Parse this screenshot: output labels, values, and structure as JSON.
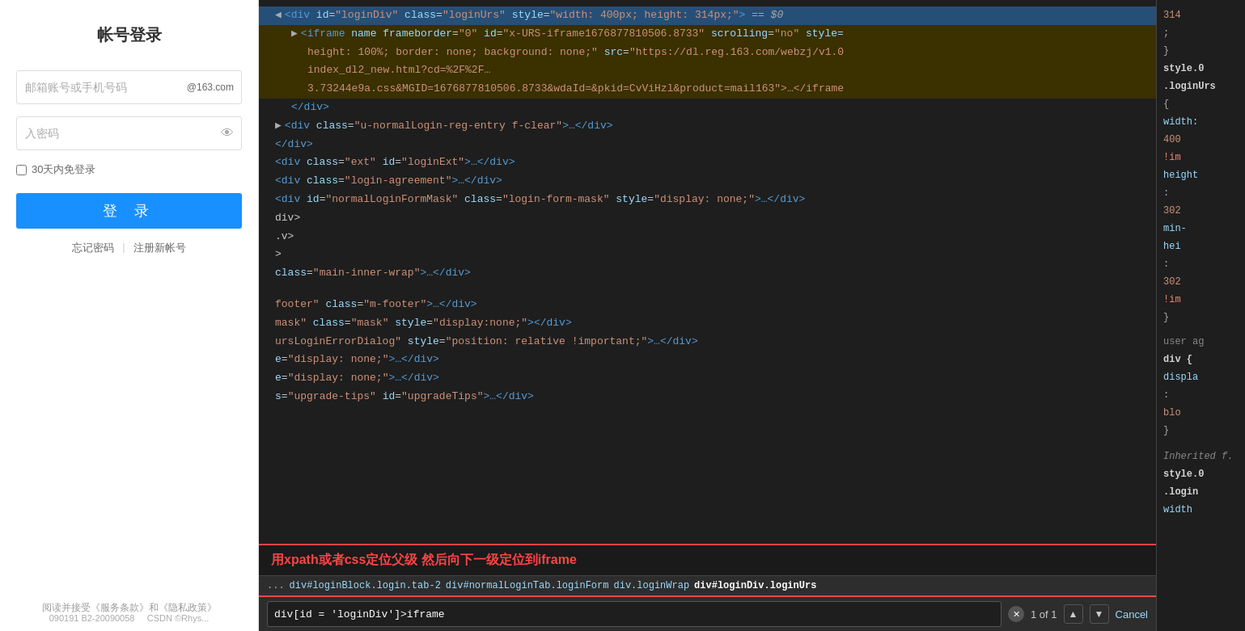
{
  "leftPanel": {
    "title": "帐号登录",
    "emailPlaceholder": "邮箱账号或手机号码",
    "emailSuffix": "@163.com",
    "passwordPlaceholder": "入密码",
    "rememberLabel": "30天内免登录",
    "loginButton": "登 录",
    "forgotPassword": "忘记密码",
    "registerLink": "注册新帐号",
    "agreementText": "阅读并接受《服务条款》和《隐私政策》",
    "footerText": "090191  B2-20090058",
    "csdn": "CSDN ©Rhys..."
  },
  "devtools": {
    "lines": [
      {
        "id": "line1",
        "type": "selected-blue",
        "content": "◀ <div id=\"loginDiv\" class=\"loginUrs\" style=\"width: 400px; height: 314px;\"> == $0"
      },
      {
        "id": "line2",
        "type": "selected-yellow",
        "content": "  ▶ <iframe name frameborder=\"0\" id=\"x-URS-iframe1676877810506.8733\" scrolling=\"no\" style="
      },
      {
        "id": "line3",
        "type": "selected-yellow",
        "indent": "    ",
        "content": "      height: 100%; border: none; background: none;\" src=\"https://dl.reg.163.com/webzj/v1.0"
      },
      {
        "id": "line4",
        "type": "selected-yellow",
        "content": "      index_dl2_new.html?cd=%2F%2F…"
      },
      {
        "id": "line5",
        "type": "selected-yellow",
        "content": "      3.73244e9a.css&MGID=1676877810506.8733&wdaId=&pkid=CvViHzl&product=mail163\">…</iframe"
      },
      {
        "id": "line6",
        "type": "normal",
        "content": "    </div>"
      },
      {
        "id": "line7",
        "type": "normal",
        "content": "  ▶ <div class=\"u-normalLogin-reg-entry f-clear\">…</div>"
      },
      {
        "id": "line8",
        "type": "normal",
        "content": "</div>"
      },
      {
        "id": "line9",
        "type": "normal",
        "content": "<div class=\"ext\" id=\"loginExt\">…</div>"
      },
      {
        "id": "line10",
        "type": "normal",
        "content": "<div class=\"login-agreement\">…</div>"
      },
      {
        "id": "line11",
        "type": "normal",
        "content": "<div id=\"normalLoginFormMask\" class=\"login-form-mask\" style=\"display: none;\">…</div>"
      },
      {
        "id": "line12",
        "type": "normal",
        "content": "div>"
      },
      {
        "id": "line13",
        "type": "normal",
        "content": ".v>"
      },
      {
        "id": "line14",
        "type": "normal",
        "content": ">"
      },
      {
        "id": "line15",
        "type": "normal",
        "content": "class=\"main-inner-wrap\">…</div>"
      },
      {
        "id": "line16",
        "type": "normal",
        "content": ""
      },
      {
        "id": "line17",
        "type": "normal",
        "content": "footer\" class=\"m-footer\">…</div>"
      },
      {
        "id": "line18",
        "type": "normal",
        "content": "mask\" class=\"mask\" style=\"display:none;\"></div>"
      },
      {
        "id": "line19",
        "type": "normal",
        "content": "ursLoginErrorDialog\" style=\"position: relative !important;\">…</div>"
      },
      {
        "id": "line20",
        "type": "normal",
        "content": "e=\"display: none;\">…</div>"
      },
      {
        "id": "line21",
        "type": "normal",
        "content": "e=\"display: none;\">…</div>"
      },
      {
        "id": "line22",
        "type": "normal",
        "content": "s=\"upgrade-tips\" id=\"upgradeTips\">…</div>"
      }
    ],
    "annotationText": "用xpath或者css定位父级 然后向下一级定位到iframe",
    "breadcrumb": {
      "dots": "...",
      "items": [
        "div#loginBlock.login.tab-2",
        "div#normalLoginTab.loginForm",
        "div.loginWrap",
        "div#loginDiv.loginUrs"
      ]
    },
    "searchBar": {
      "value": "div[id = 'loginDiv']>iframe",
      "countText": "1 of 1",
      "cancelLabel": "Cancel"
    }
  },
  "rightPanel": {
    "topNumber": "314",
    "semiColon": ";",
    "closeBrace": "}",
    "styleSelector1": "style.0",
    "selectorClass": ".loginUrs",
    "openBrace": "{",
    "widthLabel": "width:",
    "widthValue": "400",
    "importantBang": "!im",
    "heightLabel": "height",
    "heightColon": ":",
    "heightValue302": "302",
    "minHeight": "min-",
    "hei": "hei",
    "colonAfter": ":",
    "val302b": "302",
    "importantBang2": "!im",
    "closeBrace2": "}",
    "userAgComment": "user ag",
    "divBrace": "div {",
    "displayLabel": "displa",
    "colonDisplay": ":",
    "blo": "blo",
    "closeBrace3": "}",
    "inheritedTitle": "Inherited f.",
    "styleSelector2": "style.0",
    "loginClass": ".login",
    "widthLabel2": "width"
  }
}
